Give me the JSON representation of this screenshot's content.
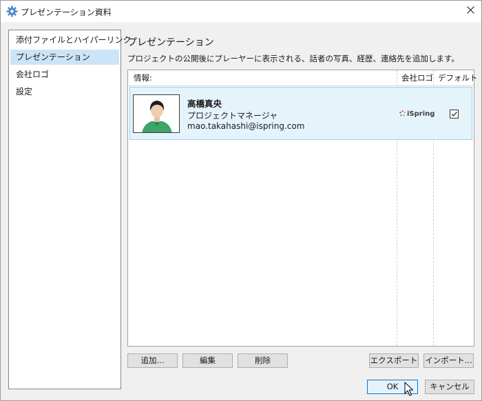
{
  "window": {
    "title": "プレゼンテーション資料"
  },
  "sidebar": {
    "items": [
      {
        "label": "添付ファイルとハイパーリンク"
      },
      {
        "label": "プレゼンテーション"
      },
      {
        "label": "会社ロゴ"
      },
      {
        "label": "設定"
      }
    ],
    "selected_index": 1
  },
  "main": {
    "title": "プレゼンテーション",
    "description": "プロジェクトの公開後にプレーヤーに表示される、話者の写真、経歴、連絡先を追加します。",
    "table": {
      "columns": [
        "情報:",
        "会社ロゴ",
        "デフォルト"
      ],
      "rows": [
        {
          "name": "高橋真央",
          "title": "プロジェクトマネージャ",
          "email": "mao.takahashi@ispring.com",
          "logo_text": "iSpring",
          "default_checked": true
        }
      ]
    }
  },
  "buttons": {
    "add": "追加...",
    "edit": "編集",
    "delete": "削除",
    "export": "エクスポート",
    "import": "インポート...",
    "ok": "OK",
    "cancel": "キャンセル"
  },
  "colors": {
    "selection": "#cce4f7",
    "row_highlight": "#e5f3fb",
    "row_border": "#99d1f0",
    "primary_border": "#0078d7"
  }
}
